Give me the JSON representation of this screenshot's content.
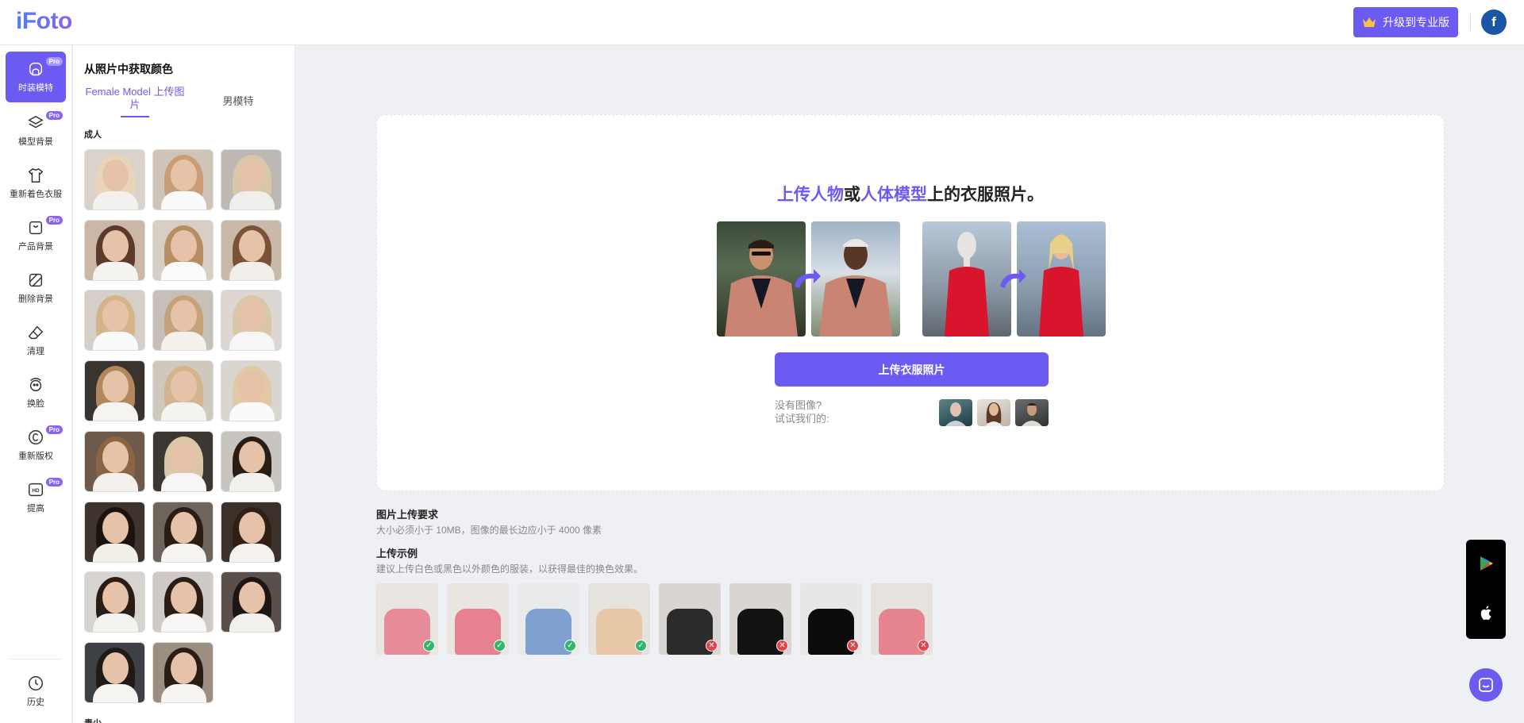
{
  "header": {
    "logo": "iFoto",
    "upgrade_label": "升级到专业版",
    "avatar_letter": "f"
  },
  "rail": {
    "items": [
      {
        "label": "时装模特",
        "pro": "Pro",
        "icon": "mannequin-icon"
      },
      {
        "label": "模型背景",
        "pro": "Pro",
        "icon": "layers-icon"
      },
      {
        "label": "重新着色衣服",
        "icon": "shirt-icon"
      },
      {
        "label": "产品背景",
        "pro": "Pro",
        "icon": "bag-icon"
      },
      {
        "label": "删除背景",
        "icon": "remove-bg-icon"
      },
      {
        "label": "清理",
        "icon": "eraser-icon"
      },
      {
        "label": "换脸",
        "icon": "face-swap-icon"
      },
      {
        "label": "重新版权",
        "pro": "Pro",
        "icon": "copyright-icon"
      },
      {
        "label": "提高",
        "pro": "Pro",
        "icon": "hd-icon"
      }
    ],
    "history_label": "历史"
  },
  "panel": {
    "title": "从照片中获取颜色",
    "tab_female": "Female Model 上传图片",
    "tab_male": "男模特",
    "section_adult": "成人",
    "section_next": "青少"
  },
  "card": {
    "title_part1": "上传人物",
    "title_part2": "或",
    "title_part3": "人体模型",
    "title_part4": "上的衣服照片。",
    "upload_label": "上传衣服照片",
    "try_line1": "没有图像?",
    "try_line2": "试试我们的:"
  },
  "requirements": {
    "title": "图片上传要求",
    "text": "大小必须小于 10MB，图像的最长边应小于 4000 像素",
    "example_title": "上传示例",
    "example_text": "建议上传白色或黑色以外颜色的服装，以获得最佳的换色效果。",
    "examples": [
      {
        "status": "ok"
      },
      {
        "status": "ok"
      },
      {
        "status": "ok"
      },
      {
        "status": "ok"
      },
      {
        "status": "bad"
      },
      {
        "status": "bad"
      },
      {
        "status": "bad"
      },
      {
        "status": "bad"
      }
    ]
  },
  "colors": {
    "accent": "#6b5bf2"
  }
}
